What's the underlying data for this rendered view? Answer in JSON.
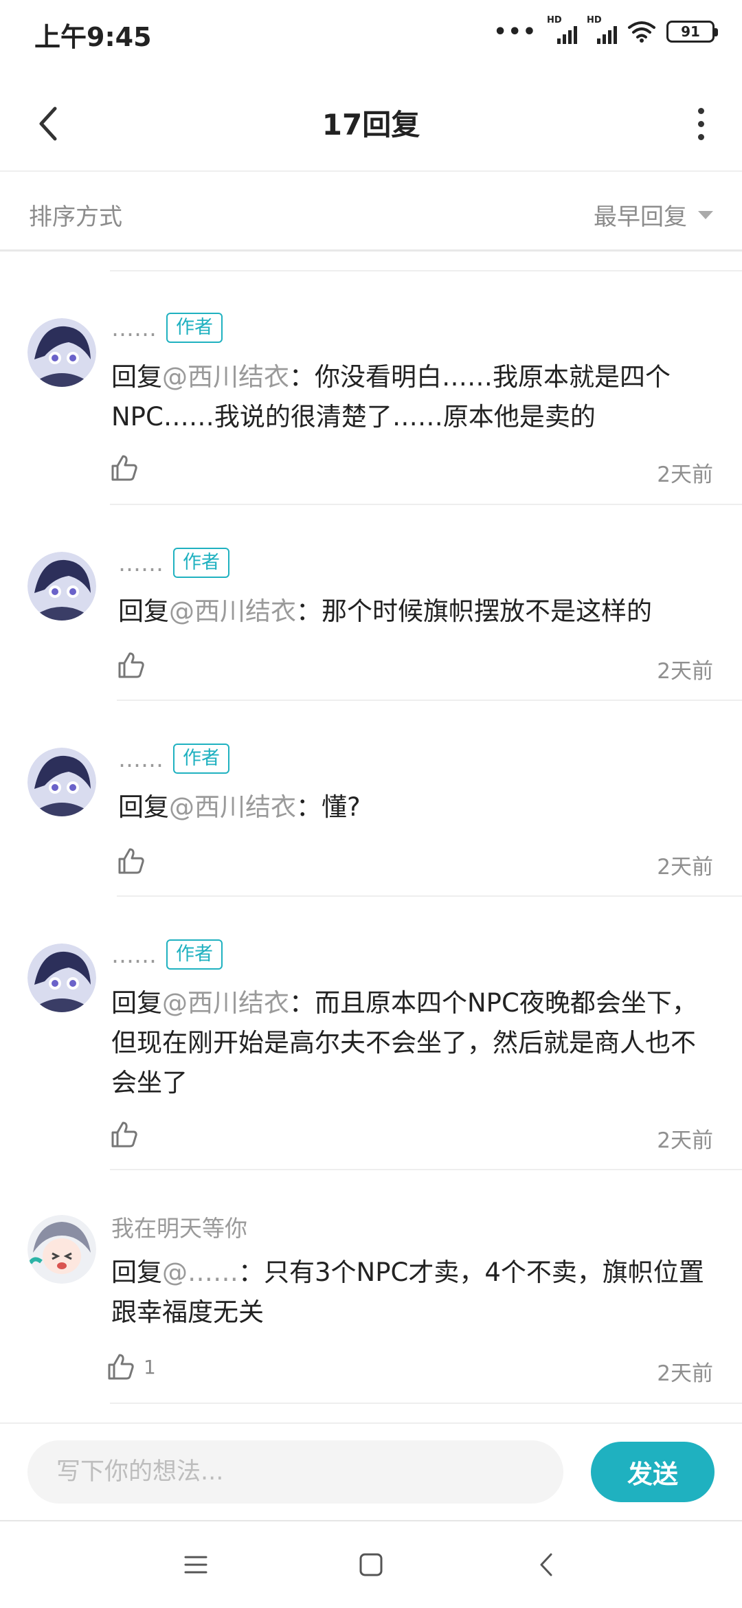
{
  "status_bar": {
    "time": "上午9:45",
    "battery": "91",
    "network_label": "HD"
  },
  "header": {
    "title": "17回复"
  },
  "sort": {
    "label": "排序方式",
    "value": "最早回复"
  },
  "comments": [
    {
      "username": "……",
      "tag": "作者",
      "reply_prefix": "回复",
      "mention": "@西川结衣",
      "text": "：你没看明白……我原本就是四个NPC……我说的很清楚了……原本他是卖的",
      "likes": "",
      "time": "2天前"
    },
    {
      "username": "……",
      "tag": "作者",
      "reply_prefix": "回复",
      "mention": "@西川结衣",
      "text": "：那个时候旗帜摆放不是这样的",
      "likes": "",
      "time": "2天前"
    },
    {
      "username": "……",
      "tag": "作者",
      "reply_prefix": "回复",
      "mention": "@西川结衣",
      "text": "：懂?",
      "likes": "",
      "time": "2天前"
    },
    {
      "username": "……",
      "tag": "作者",
      "reply_prefix": "回复",
      "mention": "@西川结衣",
      "text": "：而且原本四个NPC夜晚都会坐下，但现在刚开始是高尔夫不会坐了，然后就是商人也不会坐了",
      "likes": "",
      "time": "2天前"
    },
    {
      "username": "我在明天等你",
      "tag": "",
      "reply_prefix": "回复",
      "mention": "@……",
      "text": "：只有3个NPC才卖，4个不卖，旗帜位置跟幸福度无关",
      "likes": "1",
      "time": "2天前"
    }
  ],
  "composer": {
    "placeholder": "写下你的想法...",
    "send_label": "发送"
  },
  "colors": {
    "accent": "#1fb1c0",
    "muted_text": "#9a9a9a",
    "primary_text": "#222222"
  },
  "icons": {
    "back": "chevron-left-icon",
    "more": "more-vertical-icon",
    "like": "thumbs-up-icon",
    "nav_menu": "menu-icon",
    "nav_home": "square-home-icon",
    "nav_back": "chevron-back-icon"
  }
}
